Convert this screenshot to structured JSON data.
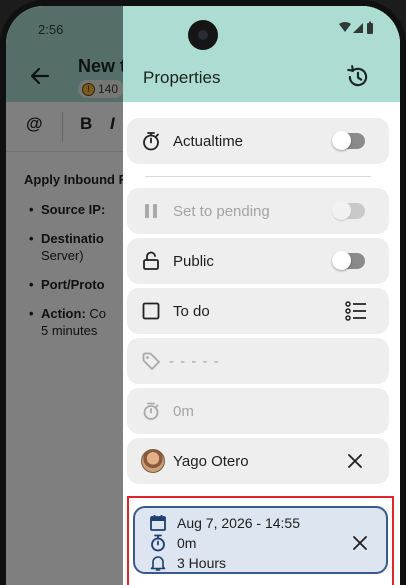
{
  "status_bar": {
    "time": "2:56"
  },
  "note": {
    "title": "New t",
    "badge_count": "140",
    "toolbar": {
      "mention": "@",
      "bold": "B",
      "italic": "I"
    },
    "heading": "Apply Inbound R",
    "bullets": [
      {
        "label": "Source IP:",
        "rest": ""
      },
      {
        "label": "Destinatio",
        "rest": "Server)"
      },
      {
        "label": "Port/Proto",
        "rest": ""
      },
      {
        "label": "Action:",
        "rest": "Co",
        "rest2": "5 minutes"
      }
    ]
  },
  "properties": {
    "title": "Properties",
    "rows": {
      "actualtime": {
        "label": "Actualtime",
        "toggle_on": false
      },
      "pending": {
        "label": "Set to pending",
        "toggle_on": false,
        "disabled": true
      },
      "public": {
        "label": "Public",
        "toggle_on": false
      },
      "todo": {
        "label": "To do"
      },
      "tags": {
        "placeholder": "- - - - -"
      },
      "time": {
        "label": "0m"
      },
      "assignee": {
        "name": "Yago Otero"
      }
    },
    "reminder": {
      "date": "Aug 7, 2026 - 14:55",
      "duration": "0m",
      "remind": "3 Hours"
    }
  },
  "colors": {
    "header_bg": "#adddd2",
    "row_bg": "#eeeeee",
    "reminder_bg": "#dde5f0",
    "reminder_border": "#3a5a8c",
    "highlight": "#e3232a"
  }
}
